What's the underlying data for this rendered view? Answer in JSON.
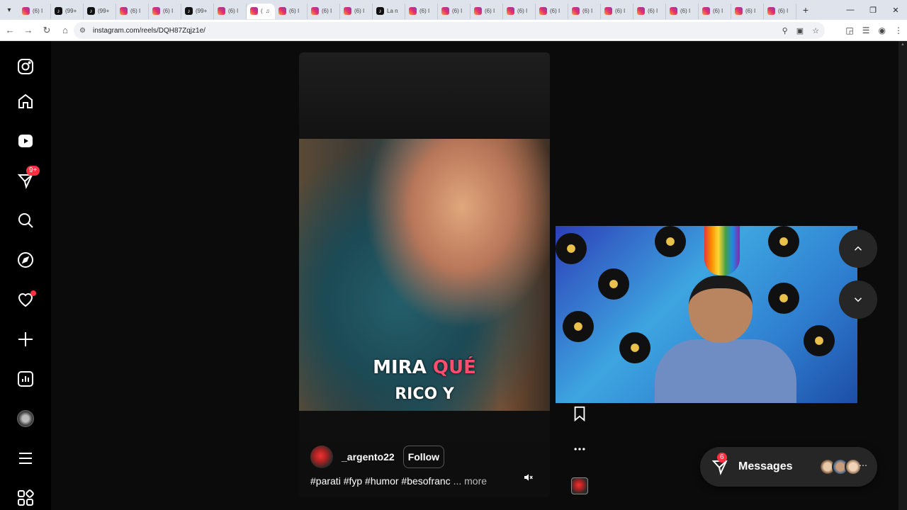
{
  "browser": {
    "tabs": [
      {
        "icon": "instagram",
        "label": "(6) I"
      },
      {
        "icon": "tiktok",
        "label": "(99+"
      },
      {
        "icon": "tiktok",
        "label": "(99+"
      },
      {
        "icon": "instagram",
        "label": "(6) I"
      },
      {
        "icon": "instagram",
        "label": "(6) I"
      },
      {
        "icon": "tiktok",
        "label": "(99+"
      },
      {
        "icon": "instagram",
        "label": "(6) I"
      },
      {
        "icon": "instagram",
        "label": "(",
        "active": true
      },
      {
        "icon": "instagram",
        "label": "(6) I"
      },
      {
        "icon": "instagram",
        "label": "(6) I"
      },
      {
        "icon": "instagram",
        "label": "(6) I"
      },
      {
        "icon": "tiktok",
        "label": "La n"
      },
      {
        "icon": "instagram",
        "label": "(6) I"
      },
      {
        "icon": "instagram",
        "label": "(6) I"
      },
      {
        "icon": "instagram",
        "label": "(6) I"
      },
      {
        "icon": "instagram",
        "label": "(6) I"
      },
      {
        "icon": "instagram",
        "label": "(6) I"
      },
      {
        "icon": "instagram",
        "label": "(6) I"
      },
      {
        "icon": "instagram",
        "label": "(6) I"
      },
      {
        "icon": "instagram",
        "label": "(6) I"
      },
      {
        "icon": "instagram",
        "label": "(6) I"
      },
      {
        "icon": "instagram",
        "label": "(6) I"
      },
      {
        "icon": "instagram",
        "label": "(6) I"
      },
      {
        "icon": "instagram",
        "label": "(6) I"
      }
    ],
    "url": "instagram.com/reels/DQH87Zqjz1e/"
  },
  "sidebar": {
    "notifications_badge": "9+",
    "items": [
      "instagram-logo",
      "home",
      "reels",
      "messages",
      "search",
      "explore",
      "notifications",
      "create",
      "dashboard",
      "profile",
      "more",
      "also-from-meta"
    ]
  },
  "reel": {
    "caption_line1_white": "MIRA",
    "caption_line1_red": "QUÉ",
    "caption_line2": "RICO Y",
    "username": "_argento22",
    "follow_label": "Follow",
    "hashtags": "#parati #fyp #humor #besofranc",
    "more_label": "... more"
  },
  "messages_bar": {
    "label": "Messages",
    "badge": "6"
  },
  "colors": {
    "badge_red": "#ff3040",
    "accent_red_caption": "#ff4d6d"
  }
}
